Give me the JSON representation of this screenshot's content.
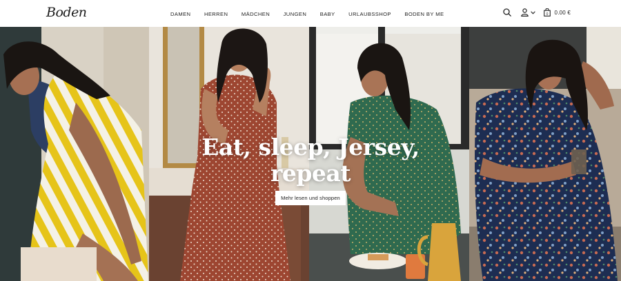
{
  "header": {
    "logo": "Boden",
    "nav": [
      "DAMEN",
      "HERREN",
      "MÄDCHEN",
      "JUNGEN",
      "BABY",
      "URLAUBSSHOP",
      "BODEN BY ME"
    ],
    "cart_total": "0.00 €",
    "icons": [
      "search-icon",
      "account-icon",
      "chevron-down-icon",
      "bag-icon"
    ]
  },
  "hero": {
    "headline_line1": "Eat, sleep, Jersey,",
    "headline_line2": "repeat",
    "cta_label": "Mehr lesen und shoppen",
    "panels": [
      "yellow-white striped dress",
      "rust polka-dot dress",
      "green polka-dot dress",
      "navy floral print dress"
    ]
  },
  "colors": {
    "yellow_stripe": "#e6c419",
    "rust_dress": "#9d4631",
    "green_dress": "#2f6a4f",
    "navy_floral": "#1d2d52",
    "header_bg": "#ffffff",
    "headline": "#ffffff"
  }
}
